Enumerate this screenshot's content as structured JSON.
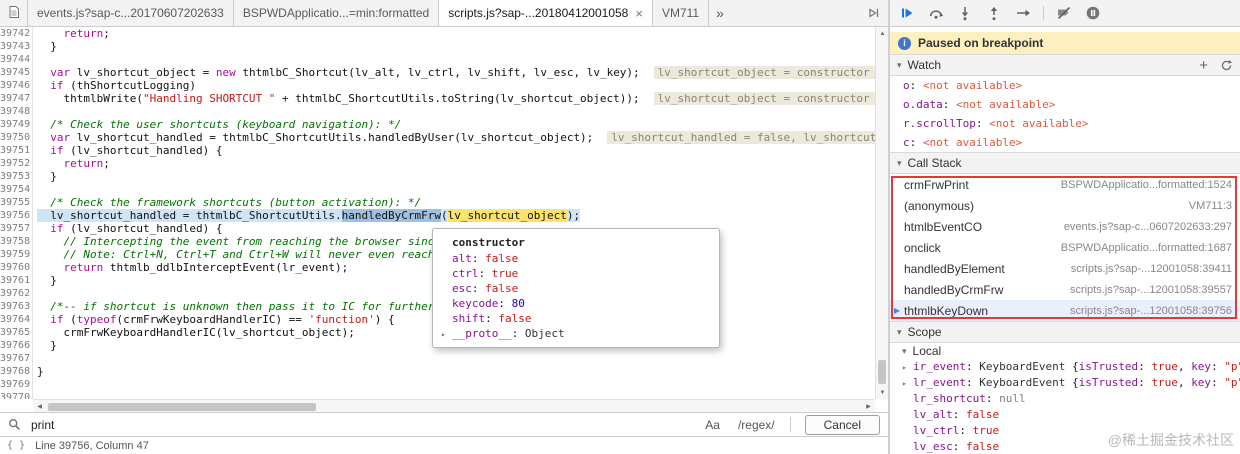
{
  "icons": {
    "tab_overflow": "»",
    "close": "×",
    "add": "+",
    "triangle_down": "▾",
    "triangle_right": "▸",
    "marker_active": "▶",
    "scroll_up": "▲",
    "scroll_down": "▼",
    "scroll_left": "◀",
    "scroll_right": "▶"
  },
  "colors": {
    "accent_blue": "#1a73e8",
    "paused_banner_bg": "#fdf0c0",
    "exec_line_bg": "#cfe4f7",
    "eval_token_bg": "#fce36c",
    "annotation_red": "#e53935"
  },
  "tabs": {
    "items": [
      {
        "label": "events.js?sap-c...20170607202633",
        "active": false
      },
      {
        "label": "BSPWDApplicatio...=min:formatted",
        "active": false
      },
      {
        "label": "scripts.js?sap-...20180412001058",
        "active": true,
        "closable": true
      },
      {
        "label": "VM711",
        "active": false
      }
    ]
  },
  "toolbar": {
    "buttons": [
      "resume",
      "step-over",
      "step-into",
      "step-out",
      "step",
      "deactivate-breakpoints",
      "pause-on-exceptions"
    ]
  },
  "editor": {
    "lines": [
      {
        "n": 39742,
        "segs": [
          {
            "t": "    "
          },
          {
            "t": "return",
            "c": "k"
          },
          {
            "t": ";"
          }
        ]
      },
      {
        "n": 39743,
        "segs": [
          {
            "t": "  }"
          }
        ]
      },
      {
        "n": 39744,
        "segs": []
      },
      {
        "n": 39745,
        "segs": [
          {
            "t": "  "
          },
          {
            "t": "var",
            "c": "k"
          },
          {
            "t": " lv_shortcut_object = "
          },
          {
            "t": "new",
            "c": "k"
          },
          {
            "t": " thtmlbC_Shortcut(lv_alt, lv_ctrl, lv_shift, lv_esc, lv_key);"
          }
        ],
        "inline": "lv_shortcut_object = constructor {alt"
      },
      {
        "n": 39746,
        "segs": [
          {
            "t": "  "
          },
          {
            "t": "if",
            "c": "k"
          },
          {
            "t": " (thShortcutLogging)"
          }
        ]
      },
      {
        "n": 39747,
        "segs": [
          {
            "t": "    thtmlbWrite("
          },
          {
            "t": "\"Handling SHORTCUT \"",
            "c": "s"
          },
          {
            "t": " + thtmlbC_ShortcutUtils.toString(lv_shortcut_object));"
          }
        ],
        "inline": "lv_shortcut_object = constructor {alt"
      },
      {
        "n": 39748,
        "segs": []
      },
      {
        "n": 39749,
        "segs": [
          {
            "t": "  "
          },
          {
            "t": "/* Check the user shortcuts (keyboard navigation): */",
            "c": "c"
          }
        ]
      },
      {
        "n": 39750,
        "segs": [
          {
            "t": "  "
          },
          {
            "t": "var",
            "c": "k"
          },
          {
            "t": " lv_shortcut_handled = thtmlbC_ShortcutUtils.handledByUser(lv_shortcut_object);"
          }
        ],
        "inline": "lv_shortcut_handled = false, lv_shortcut_obj"
      },
      {
        "n": 39751,
        "segs": [
          {
            "t": "  "
          },
          {
            "t": "if",
            "c": "k"
          },
          {
            "t": " (lv_shortcut_handled) {"
          }
        ]
      },
      {
        "n": 39752,
        "segs": [
          {
            "t": "    "
          },
          {
            "t": "return",
            "c": "k"
          },
          {
            "t": ";"
          }
        ]
      },
      {
        "n": 39753,
        "segs": [
          {
            "t": "  }"
          }
        ]
      },
      {
        "n": 39754,
        "segs": []
      },
      {
        "n": 39755,
        "segs": [
          {
            "t": "  "
          },
          {
            "t": "/* Check the framework shortcuts (button activation): */",
            "c": "c"
          }
        ]
      },
      {
        "n": 39756,
        "current": true,
        "segs": [
          {
            "t": "  lv_shortcut_handled = thtmlbC_ShortcutUtils."
          },
          {
            "t": "handledByCrmFrw",
            "c": "exec"
          },
          {
            "t": "("
          },
          {
            "t": "lv_shortcut_object",
            "c": "eval"
          },
          {
            "t": ");"
          }
        ]
      },
      {
        "n": 39757,
        "segs": [
          {
            "t": "  "
          },
          {
            "t": "if",
            "c": "k"
          },
          {
            "t": " (lv_shortcut_handled) {"
          }
        ]
      },
      {
        "n": 39758,
        "segs": [
          {
            "t": "    "
          },
          {
            "t": "// Intercepting the event from reaching the browser since it is handled",
            "c": "c"
          }
        ]
      },
      {
        "n": 39759,
        "segs": [
          {
            "t": "    "
          },
          {
            "t": "// Note: Ctrl+N, Ctrl+T and Ctrl+W will never even reach this handler",
            "c": "c"
          }
        ]
      },
      {
        "n": 39760,
        "segs": [
          {
            "t": "    "
          },
          {
            "t": "return",
            "c": "k"
          },
          {
            "t": " thtmlb_ddlbInterceptEvent(lr_event);"
          }
        ]
      },
      {
        "n": 39761,
        "segs": [
          {
            "t": "  }"
          }
        ]
      },
      {
        "n": 39762,
        "segs": []
      },
      {
        "n": 39763,
        "segs": [
          {
            "t": "  "
          },
          {
            "t": "/*-- if shortcut is unknown then pass it to IC for further processing",
            "c": "c"
          }
        ]
      },
      {
        "n": 39764,
        "segs": [
          {
            "t": "  "
          },
          {
            "t": "if",
            "c": "k"
          },
          {
            "t": " ("
          },
          {
            "t": "typeof",
            "c": "k"
          },
          {
            "t": "(crmFrwKeyboardHandlerIC) == "
          },
          {
            "t": "'function'",
            "c": "s"
          },
          {
            "t": ") {"
          }
        ]
      },
      {
        "n": 39765,
        "segs": [
          {
            "t": "    crmFrwKeyboardHandlerIC(lv_shortcut_object);"
          }
        ]
      },
      {
        "n": 39766,
        "segs": [
          {
            "t": "  }"
          }
        ]
      },
      {
        "n": 39767,
        "segs": []
      },
      {
        "n": 39768,
        "segs": [
          {
            "t": "}"
          }
        ]
      },
      {
        "n": 39769,
        "segs": []
      },
      {
        "n": 39770,
        "segs": []
      }
    ]
  },
  "popup": {
    "title": "constructor",
    "props": [
      {
        "segs": [
          {
            "t": "alt",
            "c": "name"
          },
          {
            "t": ": "
          },
          {
            "t": "false",
            "c": "bool"
          }
        ]
      },
      {
        "segs": [
          {
            "t": "ctrl",
            "c": "name"
          },
          {
            "t": ": "
          },
          {
            "t": "true",
            "c": "bool"
          }
        ]
      },
      {
        "segs": [
          {
            "t": "esc",
            "c": "name"
          },
          {
            "t": ": "
          },
          {
            "t": "false",
            "c": "bool"
          }
        ]
      },
      {
        "segs": [
          {
            "t": "keycode",
            "c": "name"
          },
          {
            "t": ": "
          },
          {
            "t": "80",
            "c": "num"
          }
        ]
      },
      {
        "segs": [
          {
            "t": "shift",
            "c": "name"
          },
          {
            "t": ": "
          },
          {
            "t": "false",
            "c": "bool"
          }
        ]
      },
      {
        "expand": true,
        "segs": [
          {
            "t": "__proto__",
            "c": "name"
          },
          {
            "t": ": "
          },
          {
            "t": "Object",
            "c": "obj"
          }
        ]
      }
    ]
  },
  "find_bar": {
    "query": "print",
    "case_label": "Aa",
    "regex_label": "/regex/",
    "cancel_label": "Cancel"
  },
  "status_bar": {
    "braces": "{ }",
    "position": "Line 39756, Column 47"
  },
  "debugger": {
    "paused_message": "Paused on breakpoint",
    "watch": {
      "title": "Watch",
      "items": [
        {
          "segs": [
            {
              "t": "o",
              "c": "name"
            },
            {
              "t": ": "
            },
            {
              "t": "<not available>",
              "c": "na"
            }
          ]
        },
        {
          "segs": [
            {
              "t": "o.data",
              "c": "name"
            },
            {
              "t": ": "
            },
            {
              "t": "<not available>",
              "c": "na"
            }
          ]
        },
        {
          "segs": [
            {
              "t": "r.scrollTop",
              "c": "name"
            },
            {
              "t": ": "
            },
            {
              "t": "<not available>",
              "c": "na"
            }
          ]
        },
        {
          "segs": [
            {
              "t": "c",
              "c": "name"
            },
            {
              "t": ": "
            },
            {
              "t": "<not available>",
              "c": "na"
            }
          ]
        }
      ]
    },
    "call_stack": {
      "title": "Call Stack",
      "frames": [
        {
          "fn": "crmFrwPrint",
          "loc": "BSPWDApplicatio...formatted:1524"
        },
        {
          "fn": "(anonymous)",
          "loc": "VM711:3"
        },
        {
          "fn": "htmlbEventCO",
          "loc": "events.js?sap-c...0607202633:297"
        },
        {
          "fn": "onclick",
          "loc": "BSPWDApplicatio...formatted:1687"
        },
        {
          "fn": "handledByElement",
          "loc": "scripts.js?sap-...12001058:39411"
        },
        {
          "fn": "handledByCrmFrw",
          "loc": "scripts.js?sap-...12001058:39557"
        },
        {
          "fn": "thtmlbKeyDown",
          "loc": "scripts.js?sap-...12001058:39756",
          "active": true
        }
      ]
    },
    "scope": {
      "title": "Scope",
      "group": "Local",
      "vars": [
        {
          "expand": true,
          "segs": [
            {
              "t": "ir_event",
              "c": "name"
            },
            {
              "t": ": "
            },
            {
              "t": "KeyboardEvent",
              "c": "obj"
            },
            {
              "t": " {"
            },
            {
              "t": "isTrusted",
              "c": "name"
            },
            {
              "t": ": "
            },
            {
              "t": "true",
              "c": "bool"
            },
            {
              "t": ", "
            },
            {
              "t": "key",
              "c": "name"
            },
            {
              "t": ": "
            },
            {
              "t": "\"p\"",
              "c": "str"
            },
            {
              "t": ", "
            }
          ]
        },
        {
          "expand": true,
          "segs": [
            {
              "t": "lr_event",
              "c": "name"
            },
            {
              "t": ": "
            },
            {
              "t": "KeyboardEvent",
              "c": "obj"
            },
            {
              "t": " {"
            },
            {
              "t": "isTrusted",
              "c": "name"
            },
            {
              "t": ": "
            },
            {
              "t": "true",
              "c": "bool"
            },
            {
              "t": ", "
            },
            {
              "t": "key",
              "c": "name"
            },
            {
              "t": ": "
            },
            {
              "t": "\"p\"",
              "c": "str"
            },
            {
              "t": ", "
            }
          ]
        },
        {
          "segs": [
            {
              "t": "lr_shortcut",
              "c": "name"
            },
            {
              "t": ": "
            },
            {
              "t": "null",
              "c": "null"
            }
          ]
        },
        {
          "segs": [
            {
              "t": "lv_alt",
              "c": "name"
            },
            {
              "t": ": "
            },
            {
              "t": "false",
              "c": "bool"
            }
          ]
        },
        {
          "segs": [
            {
              "t": "lv_ctrl",
              "c": "name"
            },
            {
              "t": ": "
            },
            {
              "t": "true",
              "c": "bool"
            }
          ]
        },
        {
          "segs": [
            {
              "t": "lv_esc",
              "c": "name"
            },
            {
              "t": ": "
            },
            {
              "t": "false",
              "c": "bool"
            }
          ]
        }
      ]
    }
  },
  "watermark": "@稀土掘金技术社区"
}
